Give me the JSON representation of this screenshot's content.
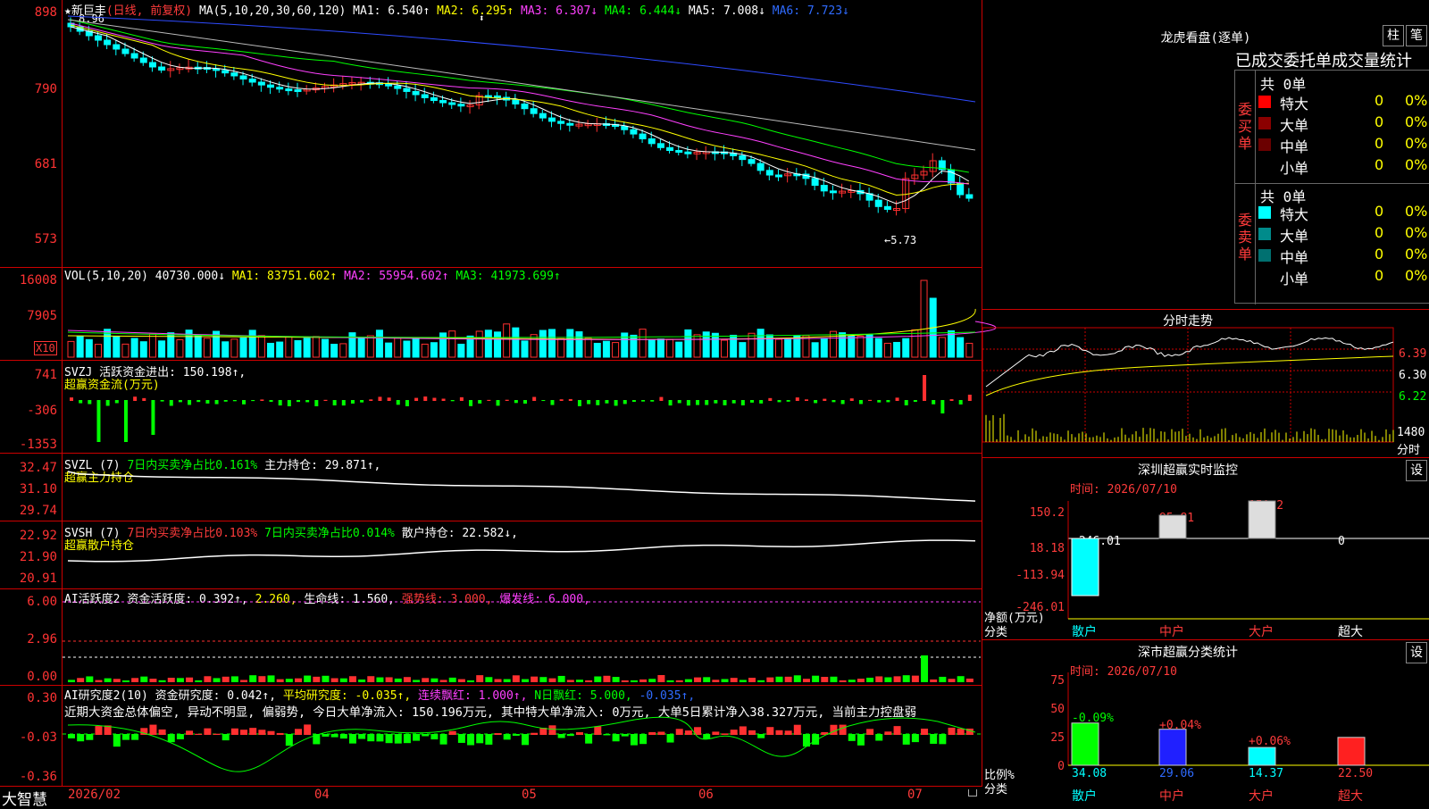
{
  "main": {
    "title_prefix": "★新巨丰",
    "title_period": "(日线, 前复权)",
    "ma_label": "MA(5,10,20,30,60,120)",
    "ma1": "MA1: 6.540↑",
    "ma2": "MA2: 6.295↑",
    "ma3": "MA3: 6.307↓",
    "ma4": "MA4: 6.444↓",
    "ma5": "MA5: 7.008↓",
    "ma6": "MA6: 7.723↓",
    "high_mark": "8.96",
    "low_mark": "←5.73",
    "y_labels": [
      "898",
      "790",
      "681",
      "573"
    ]
  },
  "vol": {
    "label": "VOL(5,10,20)",
    "value": "40730.000↓",
    "ma1": "MA1: 83751.602↑",
    "ma2": "MA2: 55954.602↑",
    "ma3": "MA3: 41973.699↑",
    "y_labels": [
      "16008",
      "7905"
    ],
    "unit": "X10"
  },
  "svzj": {
    "label": "SVZJ",
    "value": "活跃资金进出: 150.198↑,",
    "sub": "超赢资金流(万元)",
    "y_labels": [
      "741",
      "-306",
      "-1353"
    ]
  },
  "svzl": {
    "label": "SVZL (7)",
    "v1": "7日内买卖净占比0.161%",
    "v2": "主力持仓: 29.871↑,",
    "sub": "超赢主力持仓",
    "y_labels": [
      "32.47",
      "31.10",
      "29.74"
    ]
  },
  "svsh": {
    "label": "SVSH (7)",
    "v1": "7日内买卖净占比0.103%",
    "v2": "7日内买卖净占比0.014%",
    "v3": "散户持仓: 22.582↓,",
    "sub": "超赢散户持仓",
    "y_labels": [
      "22.92",
      "21.90",
      "20.91"
    ]
  },
  "ai_active": {
    "label": "AI活跃度2",
    "v1": "资金活跃度: 0.392↑,",
    "v2": "2.260,",
    "v3": "生命线: 1.560,",
    "v4": "强势线: 3.000,",
    "v5": "爆发线: 6.000,",
    "y_labels": [
      "6.00",
      "2.96",
      "0.00"
    ]
  },
  "ai_research": {
    "label": "AI研究度2(10)",
    "v1": "资金研究度: 0.042↑,",
    "v2": "平均研究度: -0.035↑,",
    "v3": "连续飘红: 1.000↑,",
    "v4": "N日飘红: 5.000,",
    "v5": "-0.035↑,",
    "comment": "近期大资金总体偏空, 异动不明显, 偏弱势, 今日大单净流入: 150.196万元, 其中特大单净流入: 0万元, 大单5日累计净入38.327万元, 当前主力控盘弱",
    "y_labels": [
      "0.30",
      "-0.03",
      "-0.36"
    ]
  },
  "footer": {
    "brand": "大智慧",
    "dates": [
      "2026/02",
      "04",
      "05",
      "06",
      "07"
    ]
  },
  "right": {
    "lhb_title": "龙虎看盘(逐单)",
    "btn_bar": "柱",
    "btn_pen": "笔",
    "section_title": "已成交委托单成交量统计",
    "buy_total": "共 0单",
    "buy_label": "委买单",
    "sell_total": "共 0单",
    "sell_label": "委卖单",
    "buy_rows": [
      {
        "name": "特大",
        "qty": "0",
        "pct": "0%",
        "color": "#ff0000"
      },
      {
        "name": "大单",
        "qty": "0",
        "pct": "0%",
        "color": "#8b0000"
      },
      {
        "name": "中单",
        "qty": "0",
        "pct": "0%",
        "color": "#6b0000"
      },
      {
        "name": "小单",
        "qty": "0",
        "pct": "0%",
        "color": ""
      }
    ],
    "sell_rows": [
      {
        "name": "特大",
        "qty": "0",
        "pct": "0%",
        "color": "#00ffff"
      },
      {
        "name": "大单",
        "qty": "0",
        "pct": "0%",
        "color": "#008b8b"
      },
      {
        "name": "中单",
        "qty": "0",
        "pct": "0%",
        "color": "#007070"
      },
      {
        "name": "小单",
        "qty": "0",
        "pct": "0%",
        "color": ""
      }
    ],
    "intraday_title": "分时走势",
    "intraday_y": [
      "6.39",
      "6.30",
      "6.22"
    ],
    "intraday_vol": "1480",
    "intraday_unit": "分时",
    "sz_title": "深圳超赢实时监控",
    "sz_btn": "设",
    "sz_time": "时间: 2026/07/10",
    "sz_y": [
      "150.2",
      "18.18",
      "-113.94",
      "-246.01"
    ],
    "sz_values": [
      "-246.01",
      "95.81",
      "150.2",
      "0"
    ],
    "sz_axis_name": "净额(万元)",
    "sz_axis_cat": "分类",
    "cats": [
      "散户",
      "中户",
      "大户",
      "超大"
    ],
    "cls_title": "深市超赢分类统计",
    "cls_btn": "设",
    "cls_time": "时间: 2026/07/10",
    "cls_y": [
      "75",
      "50",
      "25",
      "0"
    ],
    "cls_changes": [
      "-0.09%",
      "+0.04%",
      "+0.06%",
      ""
    ],
    "cls_values": [
      "34.08",
      "29.06",
      "14.37",
      "22.50"
    ],
    "cls_axis_name": "比例%",
    "cls_axis_cat": "分类"
  }
}
